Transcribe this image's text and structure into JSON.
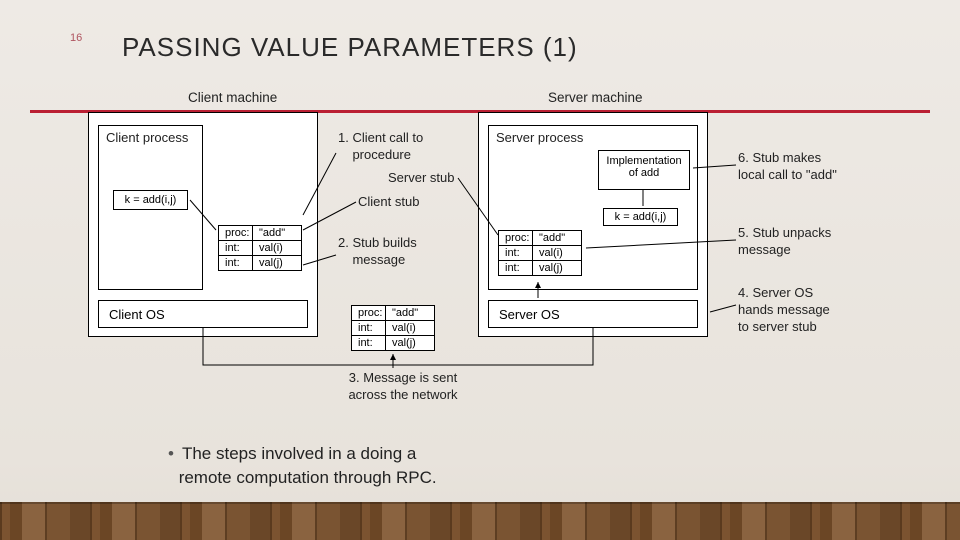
{
  "page_number": "16",
  "title": "PASSING VALUE PARAMETERS (1)",
  "bullet_line1": "The steps involved in a doing a",
  "bullet_line2": "remote computation through RPC.",
  "labels": {
    "client_machine": "Client machine",
    "server_machine": "Server machine",
    "client_process": "Client process",
    "server_process": "Server process",
    "impl_add_l1": "Implementation",
    "impl_add_l2": "of add",
    "k_eq": "k = add(i,j)",
    "client_os": "Client OS",
    "server_os": "Server OS",
    "client_stub": "Client stub",
    "server_stub": "Server stub",
    "msg_proc": "proc:",
    "msg_add": "\"add\"",
    "msg_int": "int:",
    "msg_vali": "val(i)",
    "msg_valj": "val(j)"
  },
  "steps": {
    "s1": "1. Client call to\n    procedure",
    "s2": "2. Stub builds\n    message",
    "s3_l1": "3. Message is sent",
    "s3_l2": "across the network",
    "s4_l1": "4. Server OS",
    "s4_l2": "hands message",
    "s4_l3": "to server stub",
    "s5_l1": "5. Stub unpacks",
    "s5_l2": "message",
    "s6_l1": "6. Stub makes",
    "s6_l2": "local call to \"add\""
  }
}
